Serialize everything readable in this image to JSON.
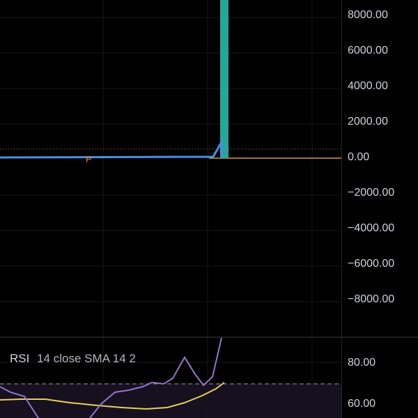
{
  "price_axis": {
    "labels": [
      "8000.00",
      "6000.00",
      "4000.00",
      "2000.00",
      "0.00",
      "−2000.00",
      "−4000.00",
      "−6000.00",
      "−8000.00"
    ]
  },
  "price_chart": {
    "marker_label": "P",
    "colors": {
      "price_line": "#4a90e2",
      "bar": "#26a69a",
      "zero_line": "#f0a030",
      "dotted_level": "#c08080",
      "grid": "#1a1a1a"
    }
  },
  "rsi_indicator": {
    "name": "RSI",
    "params": "14 close SMA 14 2",
    "axis_labels": [
      "80.00",
      "60.00"
    ],
    "colors": {
      "rsi_line": "#9575cd",
      "sma_line": "#e8d05a",
      "band": "#1a1428",
      "band_border": "#9e9e9e"
    }
  }
}
